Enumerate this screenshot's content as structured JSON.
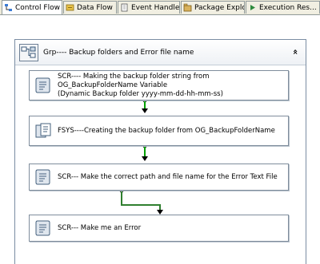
{
  "tabs": [
    {
      "label": "Control Flow",
      "active": true
    },
    {
      "label": "Data Flow",
      "active": false
    },
    {
      "label": "Event Handlers",
      "active": false
    },
    {
      "label": "Package Explo...",
      "active": false
    },
    {
      "label": "Execution Res...",
      "active": false
    }
  ],
  "group": {
    "title": "Grp---- Backup folders and Error file name",
    "collapse_glyph": "«"
  },
  "tasks": [
    {
      "line1": "SCR---- Making the backup folder string from OG_BackupFolderName Variable",
      "line2": "(Dynamic Backup folder yyyy-mm-dd-hh-mm-ss)",
      "icon": "script-task-icon"
    },
    {
      "line1": "FSYS----Creating the backup folder from OG_BackupFolderName",
      "line2": "",
      "icon": "file-system-task-icon"
    },
    {
      "line1": "SCR--- Make the correct path and file name for the Error Text File",
      "line2": "",
      "icon": "script-task-icon"
    },
    {
      "line1": "SCR--- Make me an Error",
      "line2": "",
      "icon": "script-task-icon"
    }
  ],
  "colors": {
    "precedence_success": "#00a000",
    "precedence_completion": "#2f7f2f"
  }
}
